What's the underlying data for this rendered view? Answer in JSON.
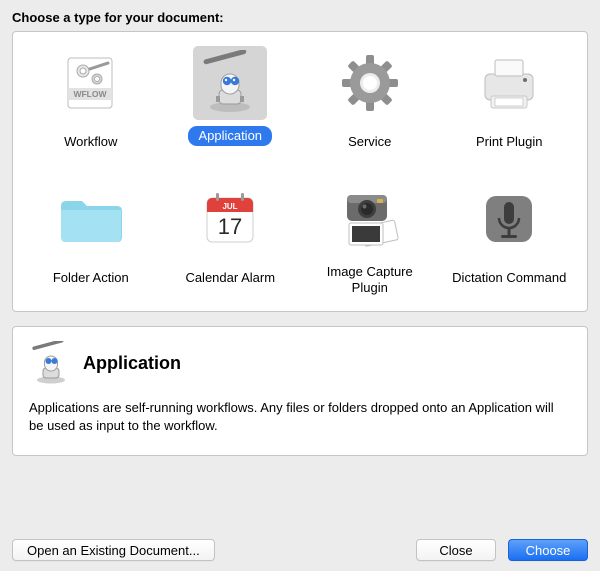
{
  "header": "Choose a type for your document:",
  "types": [
    {
      "label": "Workflow"
    },
    {
      "label": "Application"
    },
    {
      "label": "Service"
    },
    {
      "label": "Print Plugin"
    },
    {
      "label": "Folder Action"
    },
    {
      "label": "Calendar Alarm"
    },
    {
      "label": "Image Capture Plugin"
    },
    {
      "label": "Dictation Command"
    }
  ],
  "selected_index": 1,
  "calendar": {
    "month": "JUL",
    "day": "17"
  },
  "wflow_band": "WFLOW",
  "detail": {
    "title": "Application",
    "description": "Applications are self-running workflows. Any files or folders dropped onto an Application will be used as input to the workflow."
  },
  "buttons": {
    "open_existing": "Open an Existing Document...",
    "close": "Close",
    "choose": "Choose"
  }
}
